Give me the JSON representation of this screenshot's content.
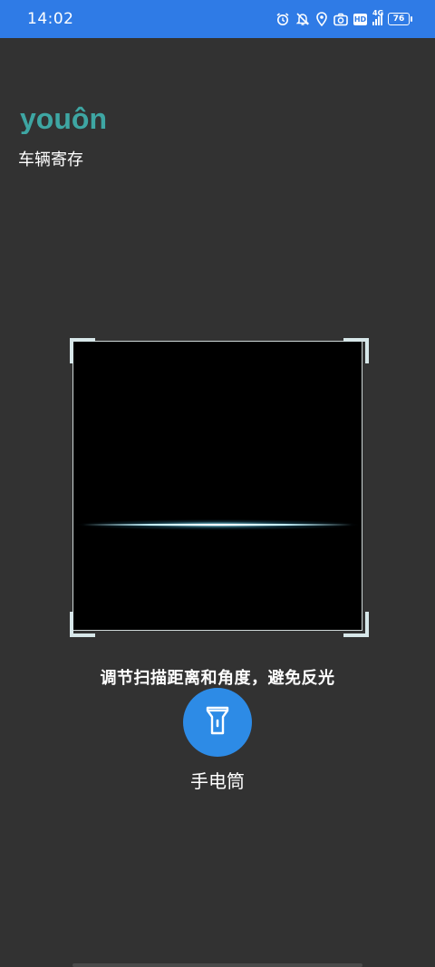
{
  "status_bar": {
    "time": "14:02",
    "icons": [
      "alarm-icon",
      "mute-icon",
      "location-icon",
      "camera-icon",
      "hd-badge",
      "signal-icon",
      "battery-icon"
    ],
    "hd_label": "HD",
    "network_label": "4G",
    "battery_level": "76",
    "color": "#2f7be6"
  },
  "brand": {
    "logo_text": "youôn",
    "logo_color": "#3ea6a3"
  },
  "page": {
    "title": "车辆寄存"
  },
  "scanner": {
    "hint": "调节扫描距离和角度，避免反光"
  },
  "flashlight": {
    "label": "手电筒",
    "icon": "flashlight-icon",
    "color": "#2d8be6"
  }
}
